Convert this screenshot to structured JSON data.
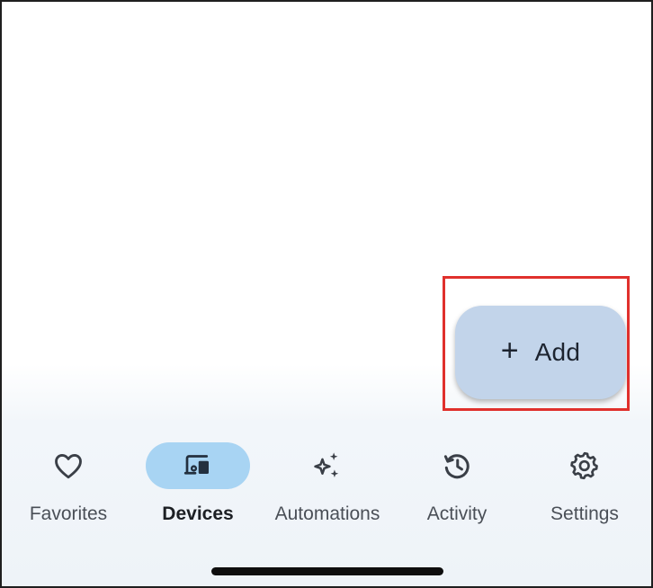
{
  "fab": {
    "icon": "plus-icon",
    "label": "Add"
  },
  "nav": {
    "items": [
      {
        "label": "Favorites",
        "icon": "heart-icon",
        "active": false
      },
      {
        "label": "Devices",
        "icon": "devices-icon",
        "active": true
      },
      {
        "label": "Automations",
        "icon": "sparkle-icon",
        "active": false
      },
      {
        "label": "Activity",
        "icon": "history-icon",
        "active": false
      },
      {
        "label": "Settings",
        "icon": "gear-icon",
        "active": false
      }
    ]
  },
  "colors": {
    "fab_background": "#c2d4ea",
    "active_pill": "#a8d4f3",
    "highlight_border": "#e0302c"
  }
}
